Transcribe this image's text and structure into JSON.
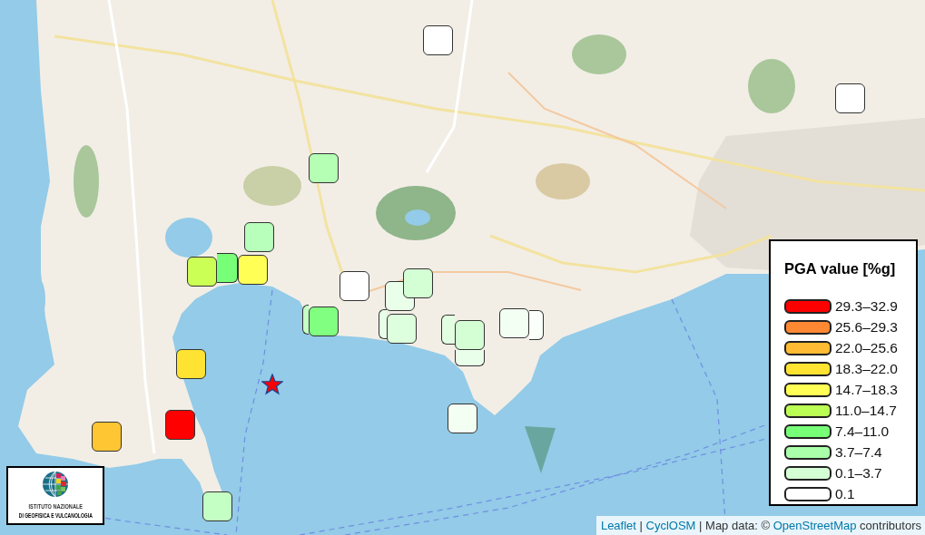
{
  "map": {
    "stations": [
      {
        "color": "#ffffff"
      },
      {
        "color": "#ffffff"
      },
      {
        "color": "#b4ffb4"
      },
      {
        "color": "#b8ffbb"
      },
      {
        "color": "#77ff77"
      },
      {
        "color": "#ccff55"
      },
      {
        "color": "#ffff55"
      },
      {
        "color": "#ffffff"
      },
      {
        "color": "#eaffea"
      },
      {
        "color": "#d4ffd4"
      },
      {
        "color": "#c4ffc4"
      },
      {
        "color": "#80ff80"
      },
      {
        "color": "#e6ffe6"
      },
      {
        "color": "#ddffdd"
      },
      {
        "color": "#e2ffe2"
      },
      {
        "color": "#eaffea"
      },
      {
        "color": "#d4ffd4"
      },
      {
        "color": "#fafffa"
      },
      {
        "color": "#f4fff4"
      },
      {
        "color": "#ffe333"
      },
      {
        "color": "#ff0000"
      },
      {
        "color": "#ffc633"
      },
      {
        "color": "#f4fff4"
      },
      {
        "color": "#c4ffc4"
      }
    ]
  },
  "legend": {
    "title": "PGA value [%g]",
    "items": [
      {
        "label": "29.3–32.9",
        "color": "#ff0000"
      },
      {
        "label": "25.6–29.3",
        "color": "#ff8833"
      },
      {
        "label": "22.0–25.6",
        "color": "#ffbb33"
      },
      {
        "label": "18.3–22.0",
        "color": "#ffe333"
      },
      {
        "label": "14.7–18.3",
        "color": "#ffff55"
      },
      {
        "label": "11.0–14.7",
        "color": "#bbff55"
      },
      {
        "label": "7.4–11.0",
        "color": "#77ff77"
      },
      {
        "label": "3.7–7.4",
        "color": "#aaffaa"
      },
      {
        "label": "0.1–3.7",
        "color": "#d4ffd4"
      },
      {
        "label": "0.1",
        "color": "#ffffff"
      }
    ]
  },
  "logo": {
    "lines": [
      "ISTITUTO NAZIONALE",
      "DI GEOFISICA E VULCANOLOGIA"
    ]
  },
  "attribution": [
    {
      "kind": "link",
      "text": "Leaflet"
    },
    {
      "kind": "text",
      "text": " | "
    },
    {
      "kind": "link",
      "text": "CyclOSM"
    },
    {
      "kind": "text",
      "text": " | Map data: © "
    },
    {
      "kind": "link",
      "text": "OpenStreetMap"
    },
    {
      "kind": "text",
      "text": " contributors"
    }
  ]
}
